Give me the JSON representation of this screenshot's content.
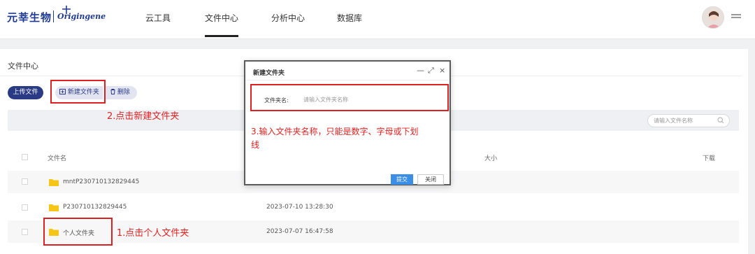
{
  "header": {
    "logo_cn": "元莘生物",
    "logo_en": "Origingene",
    "nav": [
      "云工具",
      "文件中心",
      "分析中心",
      "数据库"
    ],
    "active_nav": "文件中心"
  },
  "page": {
    "title": "文件中心",
    "buttons": {
      "upload": "上传文件",
      "new_folder": "新建文件夹",
      "delete": "删除"
    },
    "search_placeholder": "请输入文件名称"
  },
  "table": {
    "columns": {
      "name": "文件名",
      "size": "大小",
      "download": "下载"
    },
    "rows": [
      {
        "name": "mntP230710132829445",
        "date": ""
      },
      {
        "name": "P230710132829445",
        "date": "2023-07-10 13:28:30"
      },
      {
        "name": "个人文件夹",
        "date": "2023-07-07 16:47:58"
      }
    ]
  },
  "dialog": {
    "title": "新建文件夹",
    "controls": {
      "minimize": "—",
      "maximize": "⤢",
      "close": "×"
    },
    "label": "文件夹名:",
    "placeholder": "请输入文件夹名称",
    "submit": "提交",
    "close": "关闭"
  },
  "annotations": {
    "step1": "1.点击个人文件夹",
    "step2": "2.点击新建文件夹",
    "step3_line1": "3.输入文件夹名称，只能是数字、字母或下划",
    "step3_line2": "线"
  },
  "colors": {
    "brand": "#1f3a93",
    "primary_button": "#2b3a84",
    "annotation_red": "#e02020",
    "submit_blue": "#3a8ee6"
  }
}
